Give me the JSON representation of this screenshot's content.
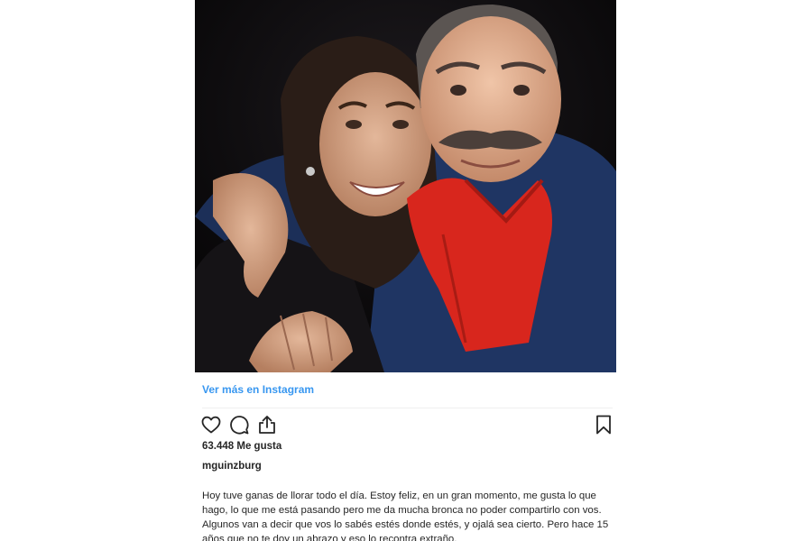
{
  "post": {
    "view_more_label": "Ver más en Instagram",
    "likes": "63.448 Me gusta",
    "username": "mguinzburg",
    "caption": "Hoy tuve ganas de llorar todo el día. Estoy feliz, en un gran momento, me gusta lo que hago, lo que me está pasando pero me da mucha bronca no poder compartirlo con vos. Algunos van a decir que vos lo sabés estés donde estés, y ojalá sea cierto. Pero hace 15 años que no te doy un abrazo y eso lo recontra extraño."
  },
  "icons": {
    "like": "heart-icon",
    "comment": "comment-icon",
    "share": "share-icon",
    "save": "bookmark-icon"
  },
  "colors": {
    "link": "#3897f0",
    "text": "#262626",
    "divider": "#efefef"
  }
}
